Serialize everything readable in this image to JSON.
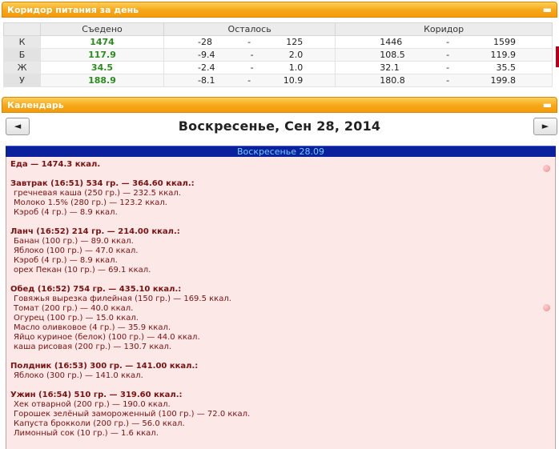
{
  "nutrition_panel": {
    "title": "Коридор питания за день",
    "collapse_icon": "minus",
    "columns": {
      "eaten": "Съедено",
      "left": "Осталось",
      "corridor": "Коридор"
    },
    "rows": [
      {
        "label": "К",
        "eaten": "1474",
        "left_min": "-28",
        "left_sep": "-",
        "left_max": "125",
        "cor_min": "1446",
        "cor_sep": "-",
        "cor_max": "1599"
      },
      {
        "label": "Б",
        "eaten": "117.9",
        "left_min": "-9.4",
        "left_sep": "-",
        "left_max": "2.0",
        "cor_min": "108.5",
        "cor_sep": "-",
        "cor_max": "119.9"
      },
      {
        "label": "Ж",
        "eaten": "34.5",
        "left_min": "-2.4",
        "left_sep": "-",
        "left_max": "1.0",
        "cor_min": "32.1",
        "cor_sep": "-",
        "cor_max": "35.5"
      },
      {
        "label": "У",
        "eaten": "188.9",
        "left_min": "-8.1",
        "left_sep": "-",
        "left_max": "10.9",
        "cor_min": "180.8",
        "cor_sep": "-",
        "cor_max": "199.8"
      }
    ]
  },
  "calendar_panel": {
    "title": "Календарь",
    "collapse_icon": "minus",
    "prev": "◄",
    "next": "►",
    "date_title": "Воскресенье, Сен 28, 2014",
    "day_bar": "Воскресенье 28.09",
    "total": "Еда — 1474.3 ккал.",
    "meals": [
      {
        "head": "Завтрак (16:51) 534 гр. — 364.60 ккал.:",
        "items": [
          "гречневая каша (250 гр.) — 232.5 ккал.",
          "Молоко 1.5% (280 гр.) — 123.2 ккал.",
          "Кэроб (4 гр.) — 8.9 ккал."
        ]
      },
      {
        "head": "Ланч (16:52) 214 гр. — 214.00 ккал.:",
        "items": [
          "Банан (100 гр.) — 89.0 ккал.",
          "Яблоко (100 гр.) — 47.0 ккал.",
          "Кэроб (4 гр.) — 8.9 ккал.",
          "орех Пекан (10 гр.) — 69.1 ккал."
        ]
      },
      {
        "head": "Обед (16:52) 754 гр. — 435.10 ккал.:",
        "items": [
          "Говяжья вырезка филейная (150 гр.) — 169.5 ккал.",
          "Томат (200 гр.) — 40.0 ккал.",
          "Огурец (100 гр.) — 15.0 ккал.",
          "Масло оливковое (4 гр.) — 35.9 ккал.",
          "Яйцо куриное (белок) (100 гр.) — 44.0 ккал.",
          "каша рисовая (200 гр.) — 130.7 ккал."
        ]
      },
      {
        "head": "Полдник (16:53) 300 гр. — 141.00 ккал.:",
        "items": [
          "Яблоко (300 гр.) — 141.0 ккал."
        ]
      },
      {
        "head": "Ужин (16:54) 510 гр. — 319.60 ккал.:",
        "items": [
          "Хек отварной (200 гр.) — 190.0 ккал.",
          "Горошек зелёный замороженный (100 гр.) — 72.0 ккал.",
          "Капуста брокколи (200 гр.) — 56.0 ккал.",
          "Лимонный сок (10 гр.) — 1.6 ккал."
        ]
      }
    ]
  }
}
